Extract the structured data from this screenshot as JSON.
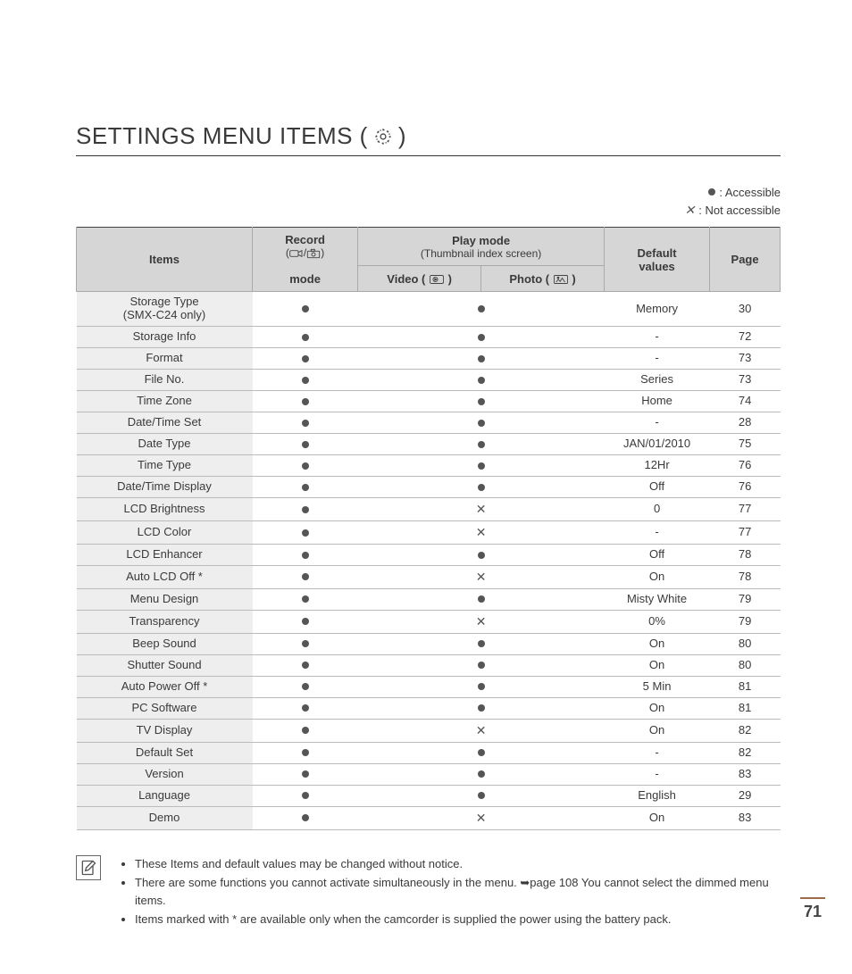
{
  "title": "SETTINGS MENU ITEMS (",
  "title_close": ")",
  "legend": {
    "accessible": ": Accessible",
    "not_accessible": ": Not accessible"
  },
  "header": {
    "items": "Items",
    "record_l1": "Record",
    "record_l2": "(",
    "record_l3": ")",
    "record_mode": "mode",
    "play_l1": "Play mode",
    "play_l2": "(Thumbnail index screen)",
    "video": "Video (",
    "video_close": ")",
    "photo": "Photo (",
    "photo_close": ")",
    "default": "Default",
    "values": "values",
    "page": "Page"
  },
  "rows": [
    {
      "item": "Storage Type",
      "item2": "(SMX-C24 only)",
      "rec": "dot",
      "play": "dot",
      "def": "Memory",
      "page": "30",
      "tall": true
    },
    {
      "item": "Storage Info",
      "rec": "dot",
      "play": "dot",
      "def": "-",
      "page": "72"
    },
    {
      "item": "Format",
      "rec": "dot",
      "play": "dot",
      "def": "-",
      "page": "73"
    },
    {
      "item": "File No.",
      "rec": "dot",
      "play": "dot",
      "def": "Series",
      "page": "73"
    },
    {
      "item": "Time Zone",
      "rec": "dot",
      "play": "dot",
      "def": "Home",
      "page": "74"
    },
    {
      "item": "Date/Time Set",
      "rec": "dot",
      "play": "dot",
      "def": "-",
      "page": "28"
    },
    {
      "item": "Date Type",
      "rec": "dot",
      "play": "dot",
      "def": "JAN/01/2010",
      "page": "75"
    },
    {
      "item": "Time Type",
      "rec": "dot",
      "play": "dot",
      "def": "12Hr",
      "page": "76"
    },
    {
      "item": "Date/Time Display",
      "rec": "dot",
      "play": "dot",
      "def": "Off",
      "page": "76"
    },
    {
      "item": "LCD Brightness",
      "rec": "dot",
      "play": "cross",
      "def": "0",
      "page": "77"
    },
    {
      "item": "LCD Color",
      "rec": "dot",
      "play": "cross",
      "def": "-",
      "page": "77"
    },
    {
      "item": "LCD Enhancer",
      "rec": "dot",
      "play": "dot",
      "def": "Off",
      "page": "78"
    },
    {
      "item": "Auto LCD Off *",
      "rec": "dot",
      "play": "cross",
      "def": "On",
      "page": "78"
    },
    {
      "item": "Menu Design",
      "rec": "dot",
      "play": "dot",
      "def": "Misty White",
      "page": "79"
    },
    {
      "item": "Transparency",
      "rec": "dot",
      "play": "cross",
      "def": "0%",
      "page": "79"
    },
    {
      "item": "Beep Sound",
      "rec": "dot",
      "play": "dot",
      "def": "On",
      "page": "80"
    },
    {
      "item": "Shutter Sound",
      "rec": "dot",
      "play": "dot",
      "def": "On",
      "page": "80"
    },
    {
      "item": "Auto Power Off *",
      "rec": "dot",
      "play": "dot",
      "def": "5 Min",
      "page": "81"
    },
    {
      "item": "PC Software",
      "rec": "dot",
      "play": "dot",
      "def": "On",
      "page": "81"
    },
    {
      "item": "TV Display",
      "rec": "dot",
      "play": "cross",
      "def": "On",
      "page": "82"
    },
    {
      "item": "Default Set",
      "rec": "dot",
      "play": "dot",
      "def": "-",
      "page": "82"
    },
    {
      "item": "Version",
      "rec": "dot",
      "play": "dot",
      "def": "-",
      "page": "83"
    },
    {
      "item": "Language",
      "rec": "dot",
      "play": "dot",
      "def": "English",
      "page": "29"
    },
    {
      "item": "Demo",
      "rec": "dot",
      "play": "cross",
      "def": "On",
      "page": "83"
    }
  ],
  "notes": [
    "These Items and default values may be changed without notice.",
    "There are some functions you cannot activate simultaneously in the menu. ➥page 108 You cannot select the dimmed menu items.",
    "Items marked with * are available only when the camcorder is supplied the power using the battery pack."
  ],
  "pagenum": "71"
}
